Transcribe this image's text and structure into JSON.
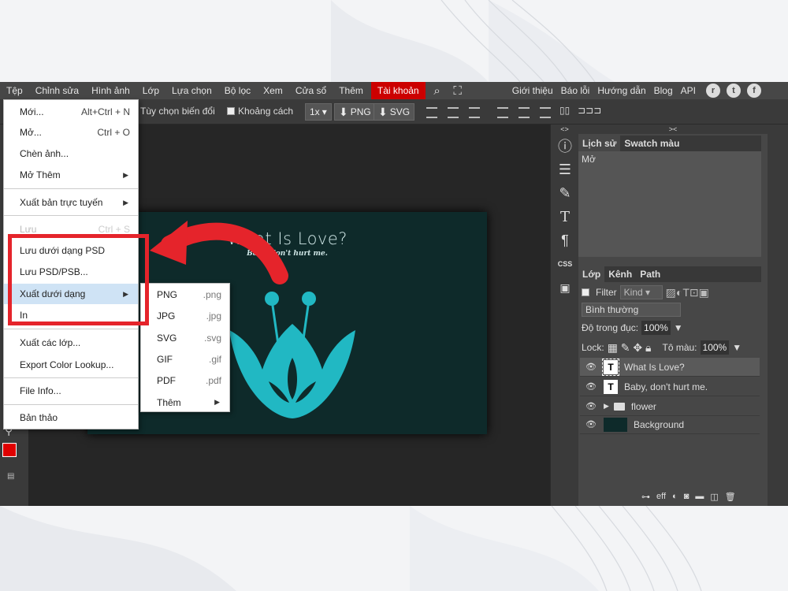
{
  "menubar": {
    "items": [
      "Tệp",
      "Chỉnh sửa",
      "Hình ảnh",
      "Lớp",
      "Lựa chọn",
      "Bộ lọc",
      "Xem",
      "Cửa sổ",
      "Thêm"
    ],
    "account": "Tài khoản",
    "right_items": [
      "Giới thiệu",
      "Báo lỗi",
      "Hướng dẫn",
      "Blog",
      "API"
    ]
  },
  "options": {
    "transform": "Tùy chọn biến đổi",
    "distance": "Khoảng cách",
    "scale": "1x",
    "png": "PNG",
    "svg": "SVG"
  },
  "document": {
    "title": "What Is Love?",
    "subtitle": "Baby, don't hurt me."
  },
  "file_menu": {
    "items": [
      {
        "label": "Mới...",
        "shortcut": "Alt+Ctrl + N"
      },
      {
        "label": "Mở...",
        "shortcut": "Ctrl + O"
      },
      {
        "label": "Chèn ảnh..."
      },
      {
        "label": "Mở Thêm"
      },
      {
        "label": "Xuất bản trực tuyến"
      },
      {
        "label": "Lưu",
        "shortcut": "Ctrl + S"
      },
      {
        "label": "Lưu dưới dạng PSD"
      },
      {
        "label": "Lưu PSD/PSB..."
      },
      {
        "label": "Xuất dưới dạng"
      },
      {
        "label": "In"
      },
      {
        "label": "Xuất các lớp..."
      },
      {
        "label": "Export Color Lookup..."
      },
      {
        "label": "File Info..."
      },
      {
        "label": "Bản thảo"
      }
    ]
  },
  "export_submenu": {
    "items": [
      {
        "label": "PNG",
        "ext": ".png"
      },
      {
        "label": "JPG",
        "ext": ".jpg"
      },
      {
        "label": "SVG",
        "ext": ".svg"
      },
      {
        "label": "GIF",
        "ext": ".gif"
      },
      {
        "label": "PDF",
        "ext": ".pdf"
      },
      {
        "label": "Thêm",
        "ext": ""
      }
    ]
  },
  "history_panel": {
    "tabs": [
      "Lịch sử",
      "Swatch màu"
    ],
    "items": [
      "Mở"
    ]
  },
  "layers_panel": {
    "tabs": [
      "Lớp",
      "Kênh",
      "Path"
    ],
    "filter": "Filter",
    "kind": "Kind",
    "blend_mode": "Bình thường",
    "opacity_label": "Độ trong đục:",
    "opacity": "100%",
    "lock_label": "Lock:",
    "fill_label": "Tô màu:",
    "fill": "100%",
    "layers": [
      "What Is Love?",
      "Baby, don't hurt me.",
      "flower",
      "Background"
    ]
  },
  "toolstrip": {
    "css": "CSS"
  },
  "colors": {
    "highlight": "#e5242b",
    "account": "#cc0000",
    "doc_bg": "#0e2a2a",
    "flower": "#21b8c3",
    "foreground": "#e00000"
  }
}
